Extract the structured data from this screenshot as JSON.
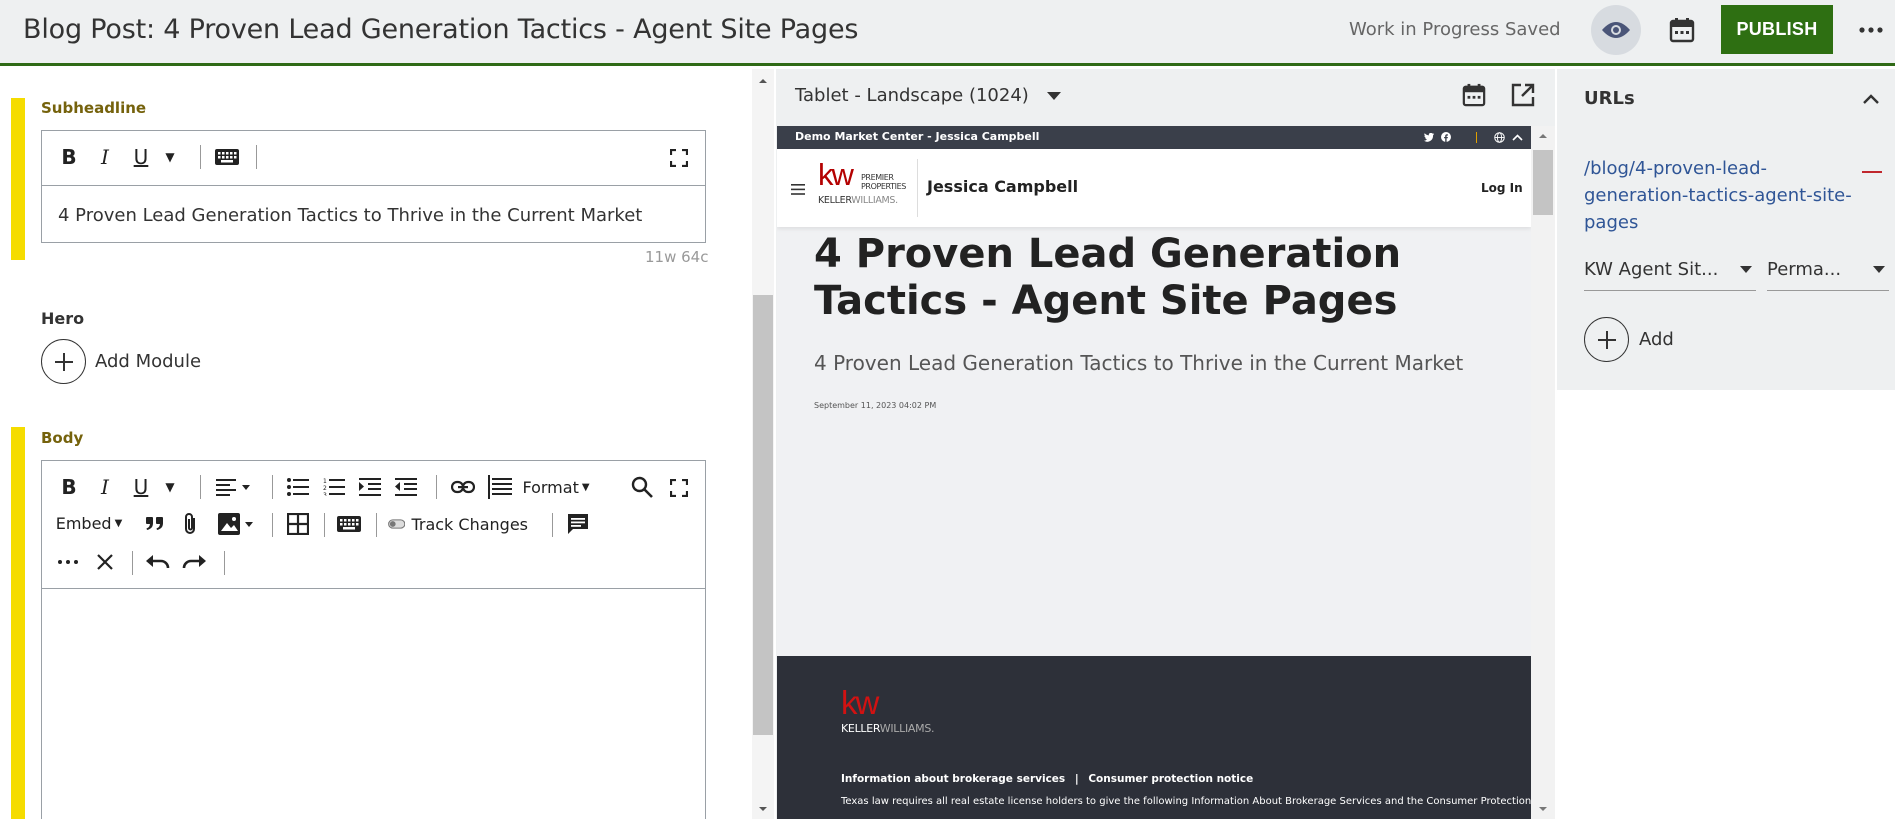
{
  "header": {
    "title": "Blog Post: 4 Proven Lead Generation Tactics - Agent Site Pages",
    "save_status": "Work in Progress Saved",
    "publish_label": "PUBLISH"
  },
  "editor": {
    "subheadline": {
      "label": "Subheadline",
      "value": "4 Proven Lead Generation Tactics to Thrive in the Current Market",
      "counter": "11w 64c"
    },
    "hero": {
      "label": "Hero",
      "add_module_label": "Add Module"
    },
    "body": {
      "label": "Body",
      "format_label": "Format",
      "embed_label": "Embed",
      "track_changes_label": "Track Changes"
    }
  },
  "preview": {
    "device": "Tablet - Landscape (1024)",
    "site": {
      "market_center": "Demo Market Center - Jessica Campbell",
      "agent_name": "Jessica Campbell",
      "login_label": "Log In",
      "logo_kw": "kw",
      "logo_premier": "PREMIER",
      "logo_properties": "PROPERTIES",
      "logo_keller": "KELLER",
      "logo_williams": "WILLIAMS."
    },
    "post": {
      "title": "4 Proven Lead Generation Tactics - Agent Site Pages",
      "subtitle": "4 Proven Lead Generation Tactics to Thrive in the Current Market",
      "date": "September 11, 2023 04:02 PM"
    },
    "footer": {
      "link1": "Information about brokerage services",
      "separator": "|",
      "link2": "Consumer protection notice",
      "notice": "Texas law requires all real estate license holders to give the following Information About Brokerage Services and the Consumer Protection Notice"
    }
  },
  "urls": {
    "title": "URLs",
    "path": "/blog/4-proven-lead-generation-tactics-agent-site-pages",
    "site_select": "KW Agent Sit...",
    "type_select": "Perma...",
    "add_label": "Add"
  },
  "colors": {
    "accent_green": "#2e6f12",
    "field_bar_yellow": "#f5dc00",
    "link_blue": "#2f5596",
    "kw_red": "#b40101"
  }
}
